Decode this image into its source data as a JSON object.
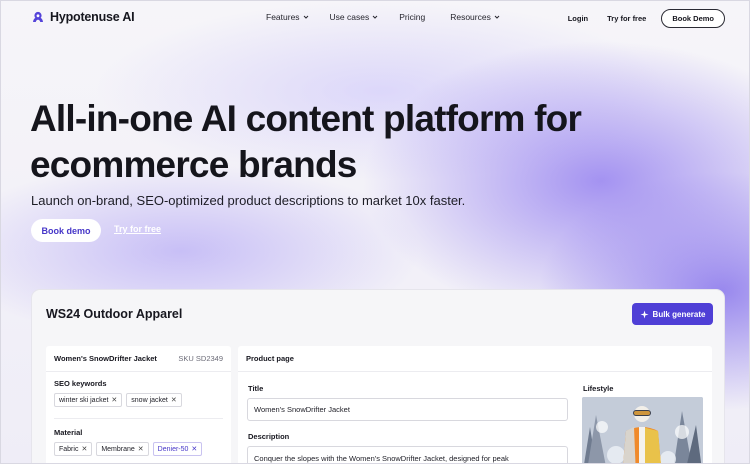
{
  "nav": {
    "brand": "Hypotenuse AI",
    "links": [
      {
        "label": "Features",
        "has_dropdown": true
      },
      {
        "label": "Use cases",
        "has_dropdown": true
      },
      {
        "label": "Pricing",
        "has_dropdown": false
      },
      {
        "label": "Resources",
        "has_dropdown": true
      }
    ],
    "login": "Login",
    "try_free": "Try for free",
    "book_demo": "Book Demo"
  },
  "hero": {
    "title_line1": "All-in-one AI content platform for",
    "title_line2": "ecommerce brands",
    "subtitle": "Launch on-brand, SEO-optimized product descriptions to market 10x faster.",
    "book_demo": "Book demo",
    "try_free": "Try for free"
  },
  "demo": {
    "title": "WS24 Outdoor Apparel",
    "bulk_generate": "Bulk generate",
    "product": {
      "name": "Women's SnowDrifter Jacket",
      "sku": "SKU SD2349",
      "seo_label": "SEO keywords",
      "seo_keywords": [
        "winter ski jacket",
        "snow jacket"
      ],
      "material_label": "Material",
      "materials": [
        "Fabric",
        "Membrane",
        "Denier-50"
      ]
    },
    "page": {
      "heading": "Product page",
      "title_label": "Title",
      "title_value": "Women's SnowDrifter Jacket",
      "description_label": "Description",
      "description_value": "Conquer the slopes with the Women's SnowDrifter Jacket, designed for peak",
      "lifestyle_label": "Lifestyle"
    }
  },
  "colors": {
    "accent": "#4f3fd6",
    "accent_text": "#4636c8",
    "gradient": "#9682f0"
  },
  "icons": {
    "logo": "hypotenuse-logo-icon",
    "dropdown": "chevron-down-icon",
    "bulk": "sparkle-icon",
    "chip_remove": "close-icon"
  }
}
